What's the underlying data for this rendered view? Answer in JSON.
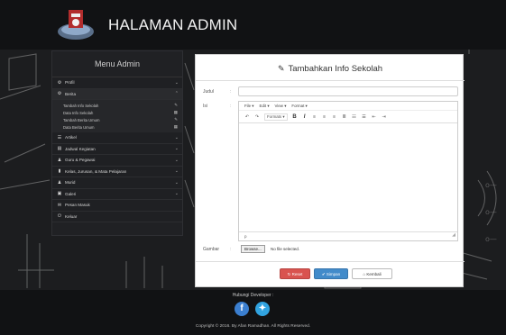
{
  "header": {
    "title": "HALAMAN ADMIN"
  },
  "sidebar": {
    "heading": "Menu Admin",
    "items": [
      {
        "label": "Profil",
        "icon": "gear-icon"
      },
      {
        "label": "Berita",
        "icon": "gear-icon",
        "active": true,
        "subitems": [
          "Tambah Info Sekolah",
          "Data Info Sekolah",
          "Tambah Berita Umum",
          "Data Berita Umum"
        ]
      },
      {
        "label": "Artikel",
        "icon": "list-icon"
      },
      {
        "label": "Jadwal Kegiatan",
        "icon": "calendar-icon"
      },
      {
        "label": "Guru & Pegawai",
        "icon": "user-icon"
      },
      {
        "label": "Kelas, Jurusan, & Mata Pelajaran",
        "icon": "bookmark-icon"
      },
      {
        "label": "Murid",
        "icon": "user-icon"
      },
      {
        "label": "Galeri",
        "icon": "image-icon"
      },
      {
        "label": "Pesan Masuk",
        "icon": "envelope-icon"
      },
      {
        "label": "Keluar",
        "icon": "power-icon"
      }
    ]
  },
  "form": {
    "title": "Tambahkan Info Sekolah",
    "judul_label": "Judul",
    "isi_label": "Isi",
    "gambar_label": "Gambar",
    "colon": ":",
    "menubar": [
      "File",
      "Edit",
      "View",
      "Format"
    ],
    "formats_label": "Formats",
    "status_path": "p",
    "browse_label": "Browse...",
    "no_file_text": "No file selected.",
    "reset_label": "Reset",
    "save_label": "Simpan",
    "back_label": "Kembali"
  },
  "footer": {
    "contact": "Hubungi Developer :",
    "copyright": "Copyright © 2016. By Afan Ramadhan. All Rights Reserved."
  },
  "colors": {
    "reset": "#d9534f",
    "save": "#428bca",
    "background": "#1c1d1f"
  }
}
